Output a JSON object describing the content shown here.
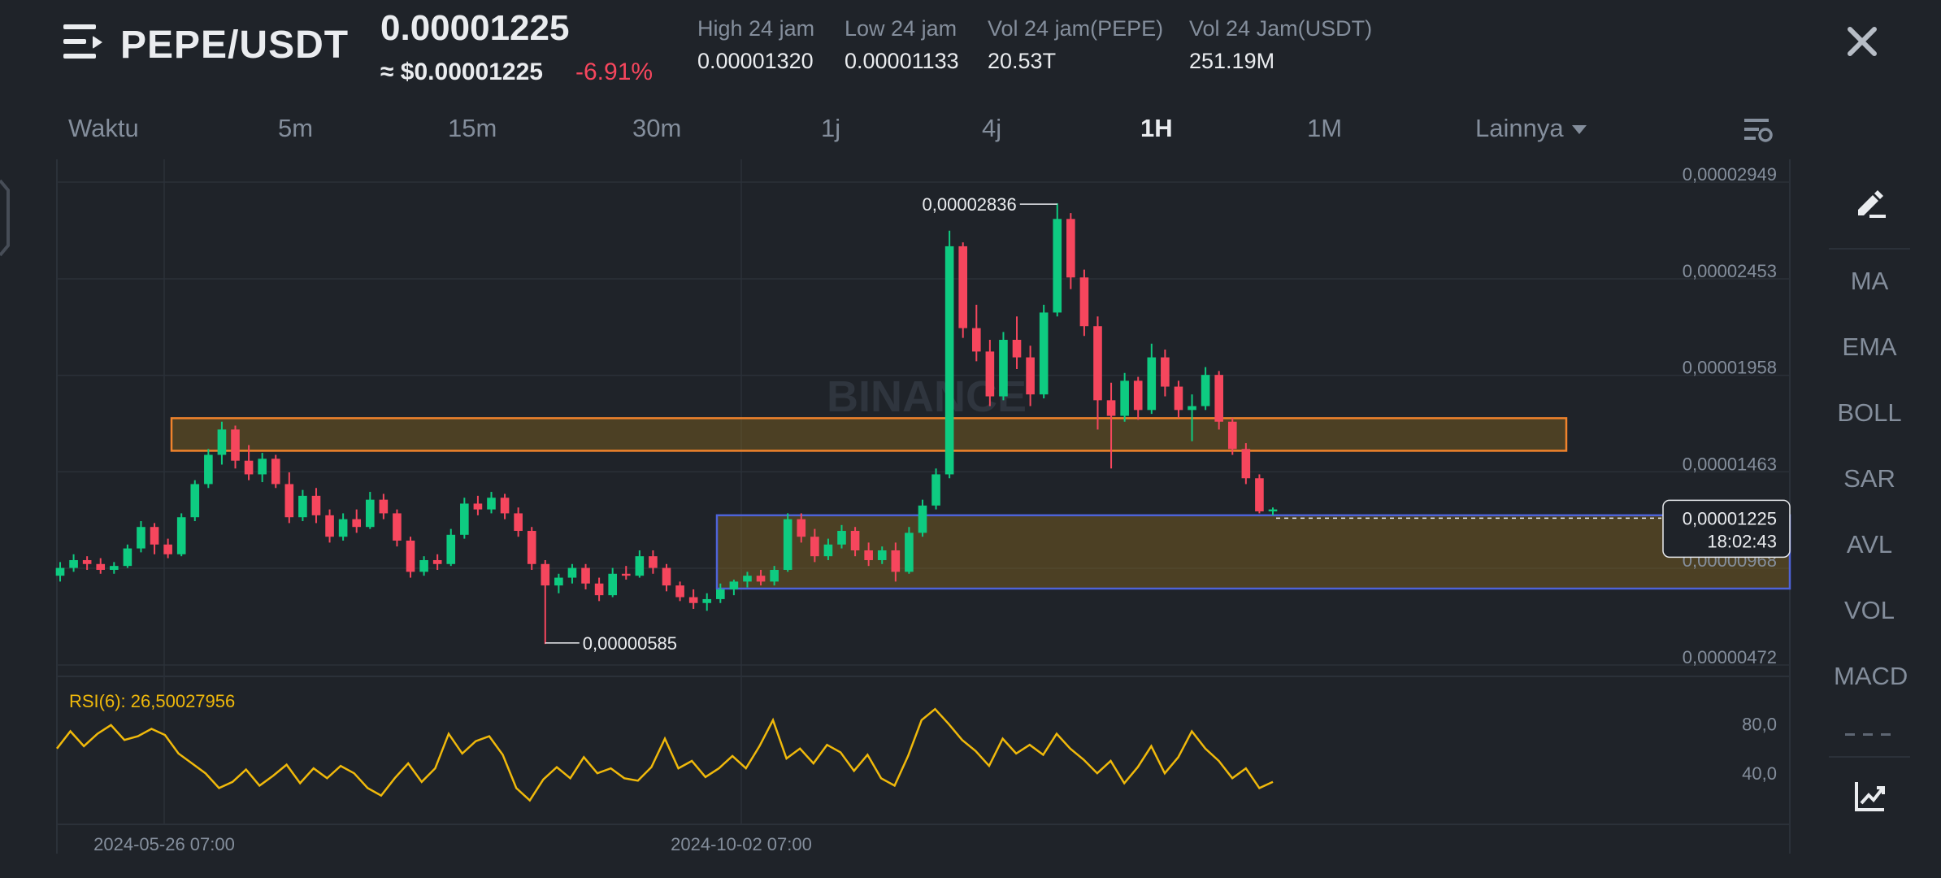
{
  "header": {
    "pair": "PEPE/USDT",
    "last_price": "0.00001225",
    "usd_price": "≈ $0.00001225",
    "change_pct": "-6.91%",
    "stats": [
      {
        "label": "High 24 jam",
        "value": "0.00001320"
      },
      {
        "label": "Low 24 jam",
        "value": "0.00001133"
      },
      {
        "label": "Vol 24 jam(PEPE)",
        "value": "20.53T"
      },
      {
        "label": "Vol 24 Jam(USDT)",
        "value": "251.19M"
      }
    ]
  },
  "tabs": {
    "items": [
      "Waktu",
      "5m",
      "15m",
      "30m",
      "1j",
      "4j",
      "1H",
      "1M",
      "Lainnya"
    ],
    "active": "1H"
  },
  "sidebar": {
    "items": [
      "MA",
      "EMA",
      "BOLL",
      "SAR",
      "AVL",
      "VOL",
      "MACD"
    ]
  },
  "chart_data": [
    {
      "type": "candlestick",
      "pair": "PEPE/USDT",
      "interval": "1H",
      "watermark": "BINANCE",
      "y_ticks": [
        "0,00002949",
        "0,00002453",
        "0,00001958",
        "0,00001463",
        "0,00000968",
        "0,00000472"
      ],
      "y_tick_values": [
        2.949e-05,
        2.453e-05,
        1.958e-05,
        1.463e-05,
        9.68e-06,
        4.72e-06
      ],
      "ylim": [
        4.72e-06,
        2.949e-05
      ],
      "x_ticks": [
        "2024-05-26 07:00",
        "2024-10-02 07:00"
      ],
      "annotations": [
        {
          "label": "0,00002836",
          "value": 2.836e-05,
          "kind": "high"
        },
        {
          "label": "0,00000585",
          "value": 5.85e-06,
          "kind": "low"
        }
      ],
      "current_price": {
        "label": "0,00001225",
        "value": 1.225e-05,
        "countdown": "18:02:43"
      },
      "zones": [
        {
          "color": "#f0832c",
          "low": 1.571e-05,
          "high": 1.738e-05
        },
        {
          "color": "#4e63d8",
          "low": 8.64e-06,
          "high": 1.24e-05
        }
      ],
      "up_color": "#0ecb81",
      "down_color": "#f6465d",
      "candles": [
        [
          9.3e-06,
          1e-05,
          9e-06,
          9.7e-06
        ],
        [
          9.7e-06,
          1.04e-05,
          9.5e-06,
          1.01e-05
        ],
        [
          1.01e-05,
          1.03e-05,
          9.6e-06,
          9.9e-06
        ],
        [
          9.9e-06,
          1.02e-05,
          9.4e-06,
          9.6e-06
        ],
        [
          9.6e-06,
          1e-05,
          9.4e-06,
          9.8e-06
        ],
        [
          9.8e-06,
          1.09e-05,
          9.7e-06,
          1.07e-05
        ],
        [
          1.07e-05,
          1.21e-05,
          1.05e-05,
          1.18e-05
        ],
        [
          1.18e-05,
          1.2e-05,
          1.04e-05,
          1.09e-05
        ],
        [
          1.09e-05,
          1.12e-05,
          1.02e-05,
          1.04e-05
        ],
        [
          1.04e-05,
          1.25e-05,
          1.03e-05,
          1.23e-05
        ],
        [
          1.23e-05,
          1.42e-05,
          1.21e-05,
          1.4e-05
        ],
        [
          1.4e-05,
          1.58e-05,
          1.38e-05,
          1.55e-05
        ],
        [
          1.55e-05,
          1.72e-05,
          1.5e-05,
          1.68e-05
        ],
        [
          1.68e-05,
          1.7e-05,
          1.48e-05,
          1.52e-05
        ],
        [
          1.52e-05,
          1.6e-05,
          1.42e-05,
          1.45e-05
        ],
        [
          1.45e-05,
          1.56e-05,
          1.41e-05,
          1.53e-05
        ],
        [
          1.53e-05,
          1.55e-05,
          1.38e-05,
          1.4e-05
        ],
        [
          1.4e-05,
          1.46e-05,
          1.2e-05,
          1.23e-05
        ],
        [
          1.23e-05,
          1.37e-05,
          1.21e-05,
          1.34e-05
        ],
        [
          1.34e-05,
          1.38e-05,
          1.2e-05,
          1.24e-05
        ],
        [
          1.24e-05,
          1.27e-05,
          1.1e-05,
          1.13e-05
        ],
        [
          1.13e-05,
          1.25e-05,
          1.11e-05,
          1.22e-05
        ],
        [
          1.22e-05,
          1.27e-05,
          1.15e-05,
          1.18e-05
        ],
        [
          1.18e-05,
          1.36e-05,
          1.17e-05,
          1.32e-05
        ],
        [
          1.32e-05,
          1.35e-05,
          1.22e-05,
          1.25e-05
        ],
        [
          1.25e-05,
          1.27e-05,
          1.08e-05,
          1.11e-05
        ],
        [
          1.11e-05,
          1.13e-05,
          9.2e-06,
          9.5e-06
        ],
        [
          9.5e-06,
          1.03e-05,
          9.3e-06,
          1.01e-05
        ],
        [
          1.01e-05,
          1.04e-05,
          9.6e-06,
          9.9e-06
        ],
        [
          9.9e-06,
          1.17e-05,
          9.8e-06,
          1.14e-05
        ],
        [
          1.14e-05,
          1.33e-05,
          1.12e-05,
          1.3e-05
        ],
        [
          1.3e-05,
          1.34e-05,
          1.24e-05,
          1.27e-05
        ],
        [
          1.27e-05,
          1.36e-05,
          1.25e-05,
          1.33e-05
        ],
        [
          1.33e-05,
          1.35e-05,
          1.22e-05,
          1.25e-05
        ],
        [
          1.25e-05,
          1.28e-05,
          1.13e-05,
          1.16e-05
        ],
        [
          1.16e-05,
          1.18e-05,
          9.6e-06,
          9.9e-06
        ],
        [
          9.9e-06,
          1.01e-05,
          5.8e-06,
          8.8e-06
        ],
        [
          8.8e-06,
          9.4e-06,
          8.4e-06,
          9.2e-06
        ],
        [
          9.2e-06,
          9.9e-06,
          8.9e-06,
          9.7e-06
        ],
        [
          9.7e-06,
          9.9e-06,
          8.6e-06,
          8.9e-06
        ],
        [
          8.9e-06,
          9.2e-06,
          8e-06,
          8.3e-06
        ],
        [
          8.3e-06,
          9.7e-06,
          8.2e-06,
          9.4e-06
        ],
        [
          9.4e-06,
          9.8e-06,
          9.1e-06,
          9.3e-06
        ],
        [
          9.3e-06,
          1.06e-05,
          9.2e-06,
          1.03e-05
        ],
        [
          1.03e-05,
          1.06e-05,
          9.4e-06,
          9.7e-06
        ],
        [
          9.7e-06,
          9.9e-06,
          8.5e-06,
          8.8e-06
        ],
        [
          8.8e-06,
          9e-06,
          8e-06,
          8.2e-06
        ],
        [
          8.2e-06,
          8.6e-06,
          7.6e-06,
          7.9e-06
        ],
        [
          7.9e-06,
          8.4e-06,
          7.5e-06,
          8.1e-06
        ],
        [
          8.1e-06,
          8.9e-06,
          7.9e-06,
          8.6e-06
        ],
        [
          8.6e-06,
          9.1e-06,
          8.3e-06,
          9e-06
        ],
        [
          9e-06,
          9.5e-06,
          8.7e-06,
          9.3e-06
        ],
        [
          9.3e-06,
          9.6e-06,
          8.8e-06,
          9e-06
        ],
        [
          9e-06,
          9.8e-06,
          8.8e-06,
          9.6e-06
        ],
        [
          9.6e-06,
          1.25e-05,
          9.5e-06,
          1.22e-05
        ],
        [
          1.22e-05,
          1.25e-05,
          1.1e-05,
          1.13e-05
        ],
        [
          1.13e-05,
          1.17e-05,
          1e-05,
          1.03e-05
        ],
        [
          1.03e-05,
          1.12e-05,
          1.01e-05,
          1.09e-05
        ],
        [
          1.09e-05,
          1.19e-05,
          1.07e-05,
          1.16e-05
        ],
        [
          1.16e-05,
          1.18e-05,
          1.03e-05,
          1.06e-05
        ],
        [
          1.06e-05,
          1.1e-05,
          9.8e-06,
          1.01e-05
        ],
        [
          1.01e-05,
          1.08e-05,
          9.9e-06,
          1.06e-05
        ],
        [
          1.06e-05,
          1.1e-05,
          9e-06,
          9.5e-06
        ],
        [
          9.5e-06,
          1.18e-05,
          9.4e-06,
          1.15e-05
        ],
        [
          1.15e-05,
          1.32e-05,
          1.13e-05,
          1.29e-05
        ],
        [
          1.29e-05,
          1.48e-05,
          1.27e-05,
          1.45e-05
        ],
        [
          1.45e-05,
          2.7e-05,
          1.43e-05,
          2.62e-05
        ],
        [
          2.62e-05,
          2.64e-05,
          2.15e-05,
          2.2e-05
        ],
        [
          2.2e-05,
          2.32e-05,
          2.03e-05,
          2.08e-05
        ],
        [
          2.08e-05,
          2.14e-05,
          1.8e-05,
          1.85e-05
        ],
        [
          1.85e-05,
          2.18e-05,
          1.83e-05,
          2.14e-05
        ],
        [
          2.14e-05,
          2.26e-05,
          1.99e-05,
          2.05e-05
        ],
        [
          2.05e-05,
          2.11e-05,
          1.8e-05,
          1.86e-05
        ],
        [
          1.86e-05,
          2.32e-05,
          1.84e-05,
          2.28e-05
        ],
        [
          2.28e-05,
          2.84e-05,
          2.26e-05,
          2.76e-05
        ],
        [
          2.76e-05,
          2.79e-05,
          2.4e-05,
          2.46e-05
        ],
        [
          2.46e-05,
          2.5e-05,
          2.16e-05,
          2.21e-05
        ],
        [
          2.21e-05,
          2.26e-05,
          1.68e-05,
          1.83e-05
        ],
        [
          1.83e-05,
          1.92e-05,
          1.48e-05,
          1.75e-05
        ],
        [
          1.75e-05,
          1.97e-05,
          1.72e-05,
          1.93e-05
        ],
        [
          1.93e-05,
          1.95e-05,
          1.73e-05,
          1.78e-05
        ],
        [
          1.78e-05,
          2.12e-05,
          1.76e-05,
          2.05e-05
        ],
        [
          2.05e-05,
          2.09e-05,
          1.85e-05,
          1.9e-05
        ],
        [
          1.9e-05,
          1.93e-05,
          1.74e-05,
          1.78e-05
        ],
        [
          1.78e-05,
          1.86e-05,
          1.62e-05,
          1.8e-05
        ],
        [
          1.8e-05,
          2e-05,
          1.78e-05,
          1.96e-05
        ],
        [
          1.96e-05,
          1.98e-05,
          1.68e-05,
          1.72e-05
        ],
        [
          1.72e-05,
          1.74e-05,
          1.55e-05,
          1.58e-05
        ],
        [
          1.58e-05,
          1.61e-05,
          1.4e-05,
          1.43e-05
        ],
        [
          1.43e-05,
          1.45e-05,
          1.25e-05,
          1.26e-05
        ],
        [
          1.26e-05,
          1.28e-05,
          1.24e-05,
          1.27e-05
        ]
      ]
    },
    {
      "type": "line",
      "indicator": "RSI(6)",
      "label": "RSI(6): 26,50027956",
      "current_value": 26.50027956,
      "y_ticks": [
        "80,0",
        "40,0"
      ],
      "y_tick_values": [
        80,
        40
      ],
      "ylim": [
        0,
        100
      ],
      "color": "#f0b90b",
      "values": [
        60,
        74,
        62,
        72,
        79,
        67,
        70,
        76,
        71,
        56,
        48,
        40,
        28,
        33,
        43,
        30,
        38,
        47,
        32,
        44,
        36,
        46,
        40,
        28,
        22,
        36,
        48,
        33,
        44,
        72,
        56,
        66,
        70,
        55,
        28,
        18,
        35,
        45,
        36,
        53,
        40,
        44,
        36,
        34,
        45,
        68,
        44,
        50,
        37,
        44,
        54,
        44,
        62,
        83,
        52,
        60,
        48,
        63,
        57,
        42,
        55,
        36,
        30,
        54,
        83,
        92,
        80,
        67,
        58,
        46,
        68,
        56,
        63,
        55,
        72,
        60,
        51,
        40,
        50,
        32,
        45,
        62,
        40,
        53,
        74,
        60,
        50,
        36,
        44,
        28,
        33
      ]
    }
  ]
}
